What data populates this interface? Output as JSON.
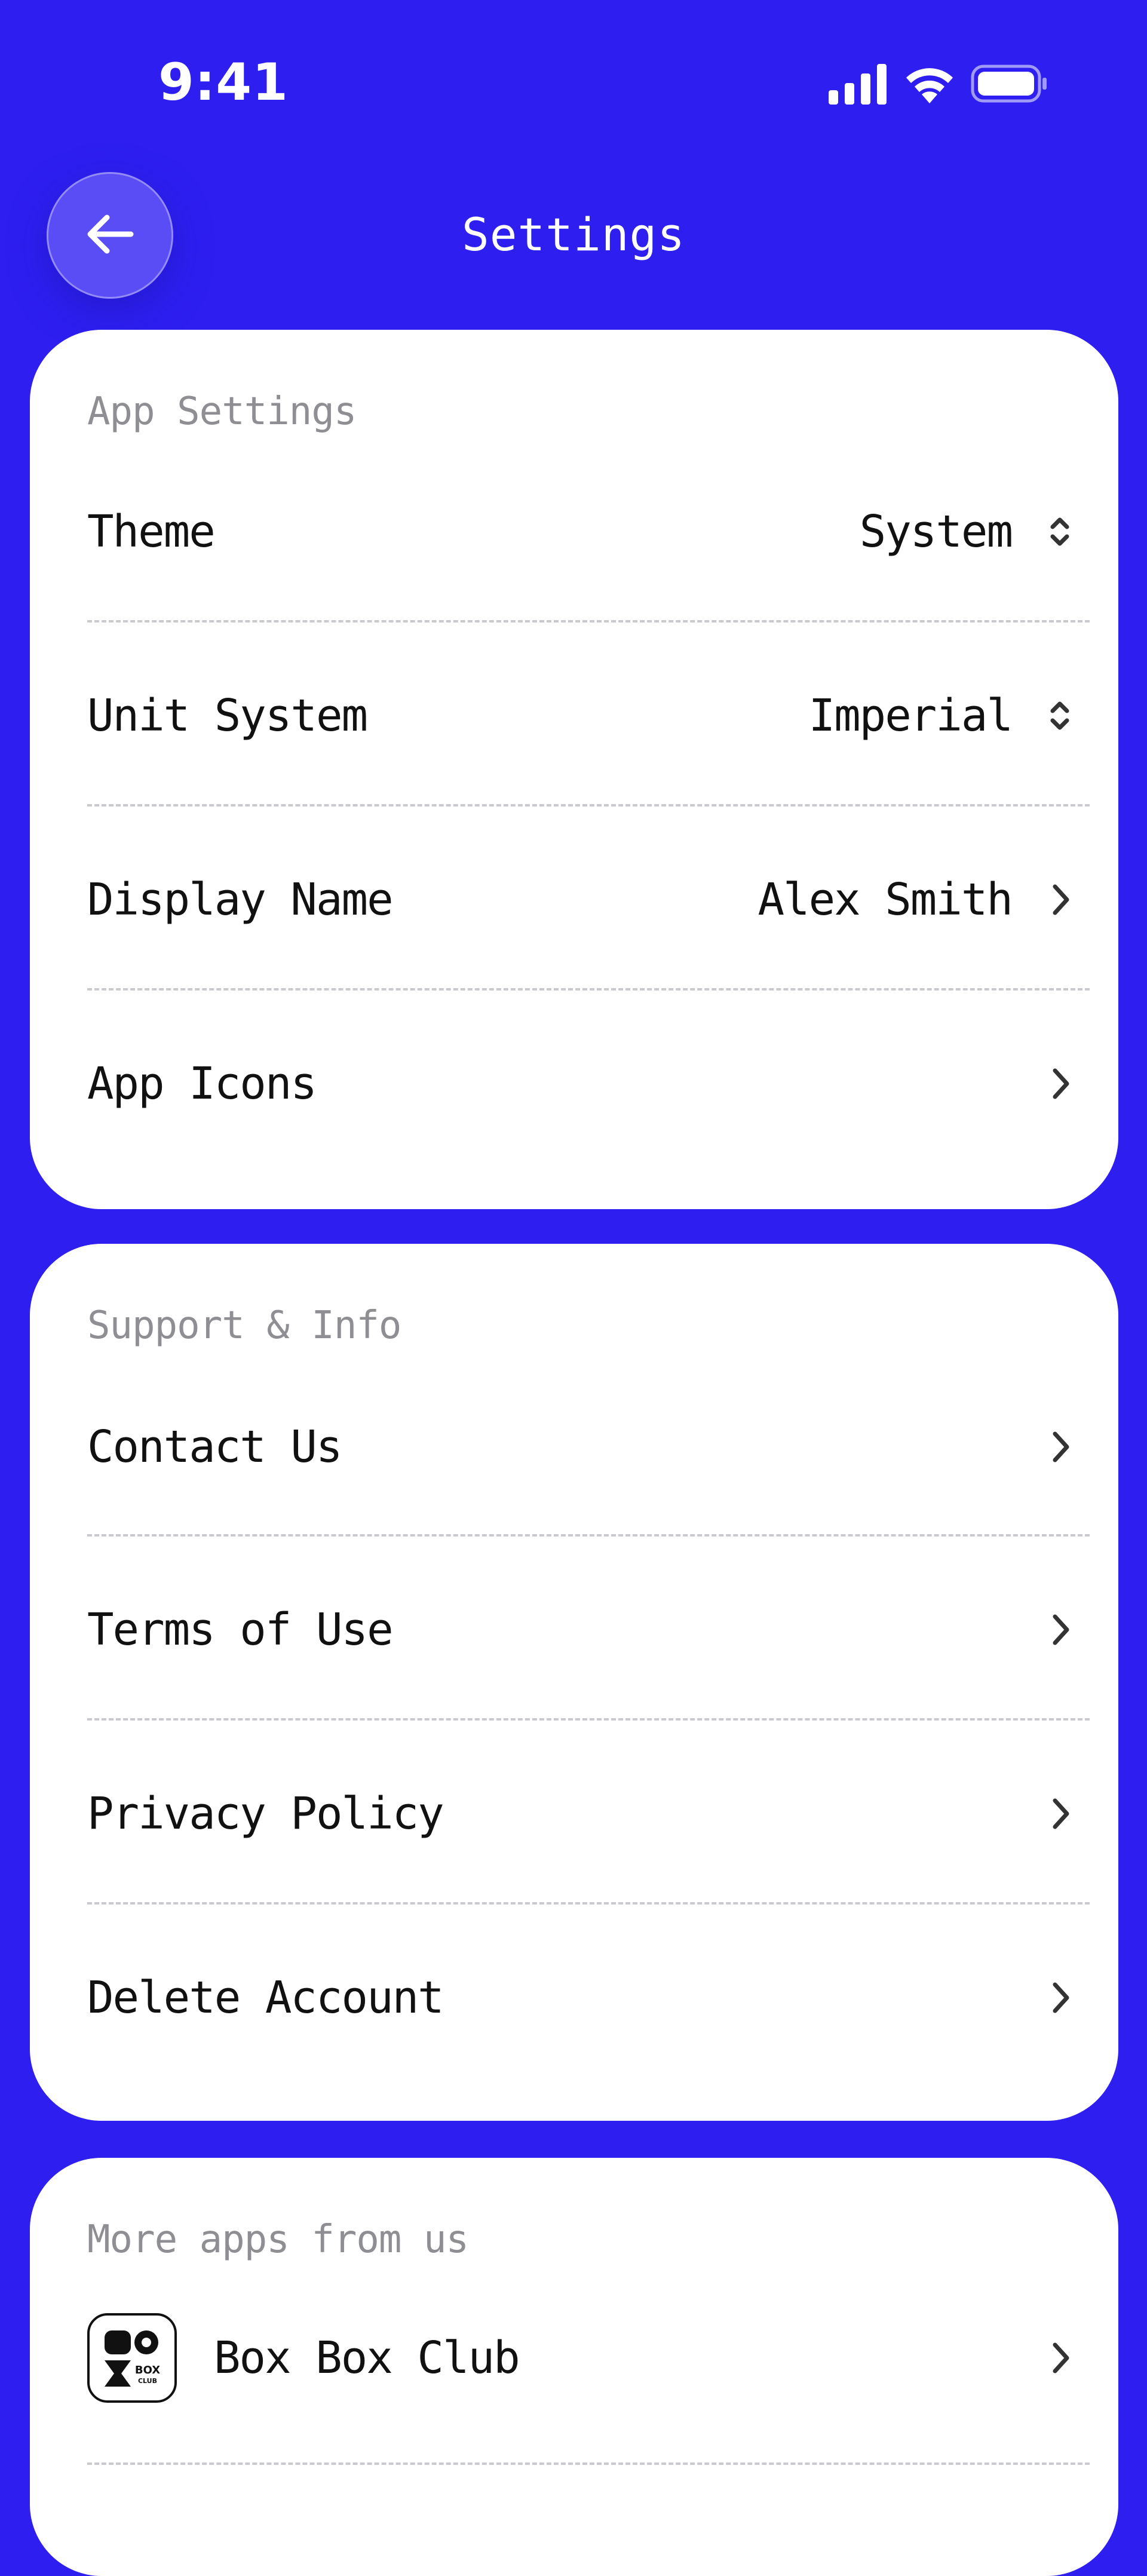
{
  "status_bar": {
    "time": "9:41",
    "icons": [
      "signal-icon",
      "wifi-icon",
      "battery-icon"
    ]
  },
  "nav": {
    "title": "Settings",
    "back_icon": "arrow-left-icon"
  },
  "app_settings": {
    "title": "App Settings",
    "rows": [
      {
        "label": "Theme",
        "value": "System",
        "icon": "up-down-chevron-icon"
      },
      {
        "label": "Unit System",
        "value": "Imperial",
        "icon": "up-down-chevron-icon"
      },
      {
        "label": "Display Name",
        "value": "Alex Smith",
        "icon": "chevron-right-icon"
      },
      {
        "label": "App Icons",
        "value": "",
        "icon": "chevron-right-icon"
      }
    ]
  },
  "support_info": {
    "title": "Support & Info",
    "rows": [
      {
        "label": "Contact Us",
        "icon": "chevron-right-icon"
      },
      {
        "label": "Terms of Use",
        "icon": "chevron-right-icon"
      },
      {
        "label": "Privacy Policy",
        "icon": "chevron-right-icon"
      },
      {
        "label": "Delete Account",
        "icon": "chevron-right-icon"
      }
    ]
  },
  "more_apps": {
    "title": "More apps from us",
    "apps": [
      {
        "name": "Box Box Club",
        "logo": "box-box-club-logo",
        "logo_text": "BOX CLUB",
        "icon": "chevron-right-icon"
      }
    ]
  },
  "colors": {
    "background": "#2E1FF0",
    "card": "#FFFFFF",
    "section_title": "#8E8E93",
    "text": "#111111",
    "divider": "#C9C9CE",
    "back_button": "#5A4DF5"
  }
}
